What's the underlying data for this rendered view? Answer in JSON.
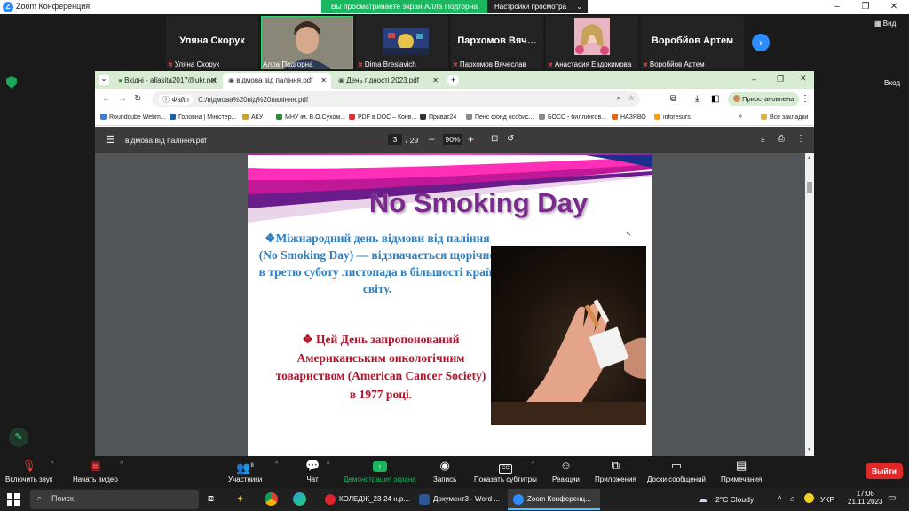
{
  "zoom": {
    "window_title": "Zoom Конференция",
    "banner_msg": "Вы просматриваете экран Алла Подгорна",
    "view_settings": "Настройки просмотра",
    "view_label": "Вид",
    "enter_label": "Вход"
  },
  "participants": [
    {
      "big": "Уляна Скорук",
      "small": "Уляна Скорук"
    },
    {
      "big": "",
      "small": "Алла Подгорна"
    },
    {
      "big": "",
      "small": "Dima Breslavich"
    },
    {
      "big": "Пархомов Вяч…",
      "small": "Пархомов Вячеслав"
    },
    {
      "big": "",
      "small": "Анастасия Евдокимова"
    },
    {
      "big": "Воробйов Артем",
      "small": "Воробйов Артем"
    }
  ],
  "browser": {
    "tabs": [
      {
        "label": "Вхідні - allasita2017@ukr.net"
      },
      {
        "label": "відмова від паління.pdf"
      },
      {
        "label": "День гідності 2023.pdf"
      }
    ],
    "file_chip": "Файл",
    "url": "C:/відмова%20від%20паління.pdf",
    "profile": "Приостановлена",
    "bookmarks": [
      "Roundcube Webm...",
      "Головна | Міністер...",
      "АКУ",
      "МНУ ім. В.О.Сухом...",
      "PDF в DOC – Конв...",
      "Приват24",
      "Пенс фонд особис...",
      "БОСС - биллингов...",
      "НАЗЯВО",
      "inforesurs"
    ],
    "all_bookmarks": "Все закладки"
  },
  "pdf": {
    "filename": "відмова від паління.pdf",
    "page_current": "3",
    "page_total": "/ 29",
    "zoom": "90%"
  },
  "slide": {
    "title": "No Smoking Day",
    "blue_text": "❖Міжнародний день відмови від паління (No Smoking Day) — відзначається щорічно в третю суботу листопада в більшості країн світу.",
    "red_text": "❖ Цей День запропонований Американським онкологічним товариством (American Cancer Society) в 1977 році."
  },
  "controls": [
    {
      "label": "Включить звук",
      "icon": "mic-muted-icon"
    },
    {
      "label": "Начать видео",
      "icon": "video-off-icon"
    },
    {
      "label": "Участники",
      "icon": "participants-icon",
      "count": "8"
    },
    {
      "label": "Чат",
      "icon": "chat-icon"
    },
    {
      "label": "Демонстрация экрана",
      "icon": "share-screen-icon"
    },
    {
      "label": "Запись",
      "icon": "record-icon"
    },
    {
      "label": "Показать субтитры",
      "icon": "captions-icon"
    },
    {
      "label": "Реакции",
      "icon": "reactions-icon"
    },
    {
      "label": "Приложения",
      "icon": "apps-icon"
    },
    {
      "label": "Доски сообщений",
      "icon": "whiteboard-icon"
    },
    {
      "label": "Примечания",
      "icon": "notes-icon"
    }
  ],
  "leave_label": "Выйти",
  "taskbar": {
    "search": "Поиск",
    "apps": [
      {
        "label": "КОЛЕДЖ_23-24 н.р...."
      },
      {
        "label": "Документ3 - Word ..."
      },
      {
        "label": "Zoom Конференц..."
      }
    ],
    "weather": "2°C  Cloudy",
    "lang": "УКР",
    "time": "17:06",
    "date": "21.11.2023"
  },
  "colors": {
    "zoom_green": "#1ab760",
    "zoom_blue": "#2d8cff",
    "leave_red": "#e02828",
    "slide_title": "#7a2a8c",
    "slide_blue": "#2f7fc0",
    "slide_red": "#b5152b"
  }
}
